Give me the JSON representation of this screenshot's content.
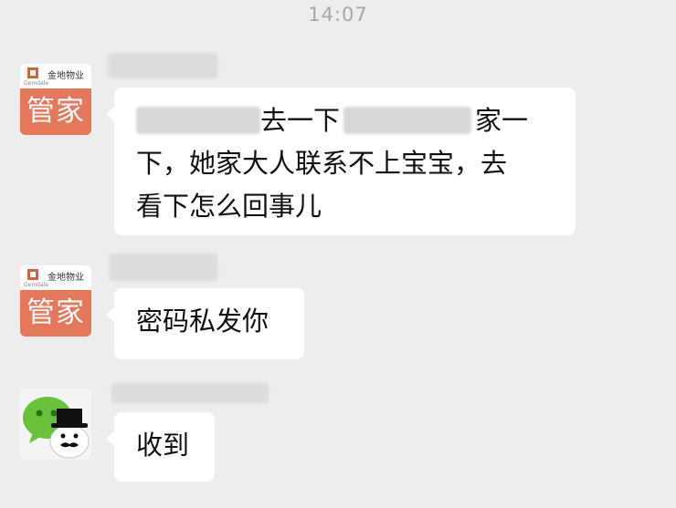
{
  "status": {
    "time": "14:07"
  },
  "messages": [
    {
      "avatar": {
        "brand": "金地物业",
        "brand_en": "Gemdale",
        "label": "管家"
      },
      "segments": [
        "去一下",
        "家一",
        "下，她家大人联系不上宝宝，去",
        "看下怎么回事儿"
      ]
    },
    {
      "avatar": {
        "brand": "金地物业",
        "brand_en": "Gemdale",
        "label": "管家"
      },
      "text": "密码私发你"
    },
    {
      "avatar": {
        "icon": "wechat-moustache-icon"
      },
      "text": "收到"
    }
  ],
  "colors": {
    "background": "#ededed",
    "bubble": "#ffffff",
    "avatar_accent": "#e5775b",
    "wechat_green": "#6ac23a"
  }
}
